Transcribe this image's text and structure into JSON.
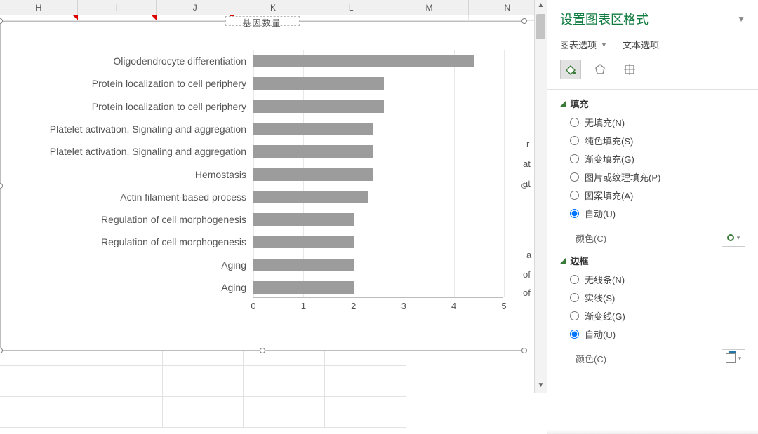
{
  "columns": [
    "H",
    "I",
    "J",
    "K",
    "L",
    "M",
    "N"
  ],
  "panel": {
    "title": "设置图表区格式",
    "tab_chart": "图表选项",
    "tab_text": "文本选项",
    "section_fill": "填充",
    "section_border": "边框",
    "fill_options": {
      "none": "无填充(N)",
      "solid": "纯色填充(S)",
      "gradient": "渐变填充(G)",
      "picture": "图片或纹理填充(P)",
      "pattern": "图案填充(A)",
      "auto": "自动(U)"
    },
    "border_options": {
      "none": "无线条(N)",
      "solid": "实线(S)",
      "gradient": "渐变线(G)",
      "auto": "自动(U)"
    },
    "color_label": "颜色(C)"
  },
  "chart_title": "基因数量",
  "chart_data": {
    "type": "bar",
    "orientation": "horizontal",
    "categories": [
      "Oligodendrocyte differentiation",
      "Protein localization to cell periphery",
      "Protein localization to cell periphery",
      "Platelet activation, Signaling and aggregation",
      "Platelet activation, Signaling and aggregation",
      "Hemostasis",
      "Actin filament-based process",
      "Regulation of cell morphogenesis",
      "Regulation of cell morphogenesis",
      "Aging",
      "Aging"
    ],
    "values": [
      4.4,
      2.6,
      2.6,
      2.4,
      2.4,
      2.4,
      2.3,
      2.0,
      2.0,
      2.0,
      2.0
    ],
    "xlim": [
      0,
      5
    ],
    "xticks": [
      0,
      1,
      2,
      3,
      4,
      5
    ],
    "title": "基因数量",
    "xlabel": "",
    "ylabel": ""
  },
  "stray_text": [
    "r",
    "at",
    "at",
    "a",
    "of",
    "of"
  ]
}
